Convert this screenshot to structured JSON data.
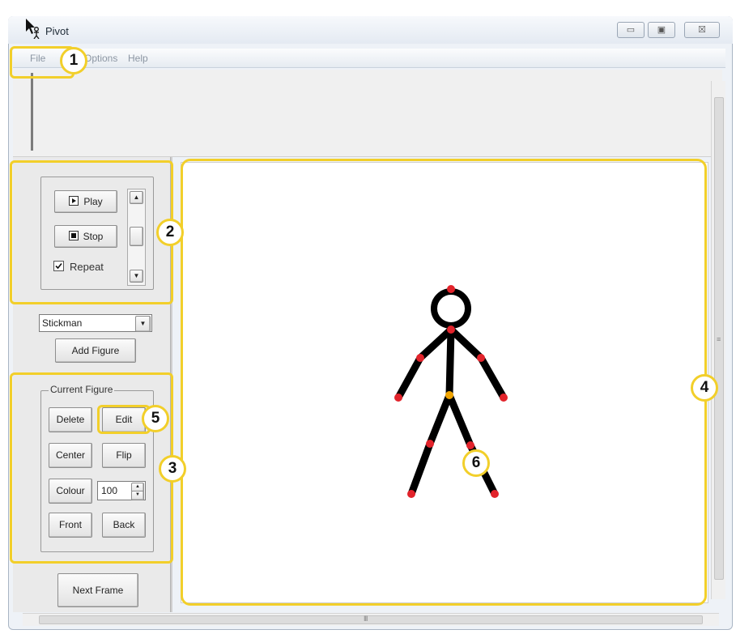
{
  "window": {
    "title": "Pivot",
    "buttons": {
      "minimize": "▭",
      "maximize": "▣",
      "close": "☒"
    }
  },
  "menu": [
    "File",
    "Options",
    "Help"
  ],
  "playback": {
    "play_label": "Play",
    "stop_label": "Stop",
    "repeat_label": "Repeat",
    "repeat_checked": true
  },
  "figure_select": {
    "selected": "Stickman",
    "add_label": "Add Figure"
  },
  "current_figure": {
    "legend": "Current Figure",
    "delete_label": "Delete",
    "edit_label": "Edit",
    "center_label": "Center",
    "flip_label": "Flip",
    "colour_label": "Colour",
    "colour_value": "100",
    "front_label": "Front",
    "back_label": "Back"
  },
  "next_frame_label": "Next Frame",
  "callouts": [
    "1",
    "2",
    "3",
    "4",
    "5",
    "6"
  ],
  "scroll": {
    "h_grip": "III",
    "v_grip": "≡"
  },
  "colors": {
    "highlight": "#f2cf2a",
    "joint": "#e2232b",
    "center_joint": "#f0a400",
    "stick": "#000000"
  }
}
